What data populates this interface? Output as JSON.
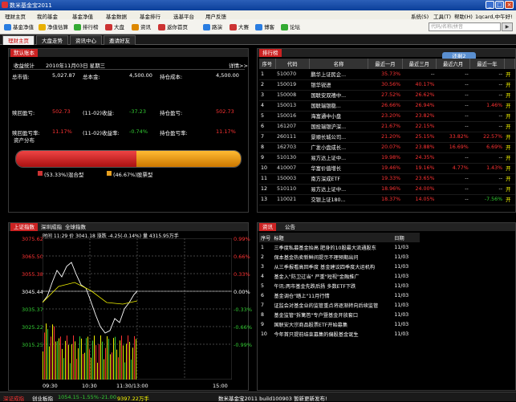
{
  "app": {
    "title": "数米基金宝2011"
  },
  "menu": [
    "理财主页",
    "我的基金",
    "基金净值",
    "基金数据",
    "基金排行",
    "选基平台",
    "用户反馈"
  ],
  "menu_right": [
    "系统(S)",
    "工具(T)",
    "帮助(H)",
    "1qcard,中午好!"
  ],
  "toolbar": [
    {
      "label": "基金净值",
      "icon": "chart-icon",
      "color": "#2a7de1"
    },
    {
      "label": "净值估算",
      "icon": "star-icon",
      "color": "#e8b000"
    },
    {
      "label": "排行榜",
      "icon": "list-icon",
      "color": "#3a3"
    },
    {
      "label": "大盘",
      "icon": "bar-chart-icon",
      "color": "#c33"
    },
    {
      "label": "资讯",
      "icon": "doc-icon",
      "color": "#d80"
    },
    {
      "label": "返你首页",
      "icon": "home-icon",
      "color": "#c33"
    },
    {
      "label": "路演",
      "icon": "mic-icon",
      "color": "#2a7de1"
    },
    {
      "label": "大赛",
      "icon": "trophy-icon",
      "color": "#c33"
    },
    {
      "label": "博客",
      "icon": "blog-icon",
      "color": "#2a7de1"
    },
    {
      "label": "论坛",
      "icon": "forum-icon",
      "color": "#3a3"
    }
  ],
  "search": {
    "placeholder": "代码/名称/拼音",
    "button": "▶"
  },
  "tabs": [
    "理财主页",
    "大盘走势",
    "资讯中心",
    "邀请好友"
  ],
  "account": {
    "tab": "默认账本",
    "header_label": "收益统计",
    "date": "2010年11月03日 星期三",
    "detail_link": "详情>>",
    "rows": [
      [
        {
          "l": "总市值:",
          "v": "5,027.87",
          "c": "white"
        },
        {
          "l": "总本金:",
          "v": "4,500.00",
          "c": "white"
        },
        {
          "l": "持仓成本:",
          "v": "4,500.00",
          "c": "white"
        }
      ],
      [
        {
          "l": "赎回盈亏:",
          "v": "502.73",
          "c": "red"
        },
        {
          "l": "(11-02)收益:",
          "v": "-37.23",
          "c": "green"
        },
        {
          "l": "持仓盈亏:",
          "v": "502.73",
          "c": "red"
        }
      ],
      [
        {
          "l": "赎回盈亏率:",
          "v": "11.17%",
          "c": "red"
        },
        {
          "l": "(11-02)收益率:",
          "v": "-0.74%",
          "c": "green"
        },
        {
          "l": "持仓盈亏率:",
          "v": "11.17%",
          "c": "red"
        }
      ]
    ],
    "distribution_label": "资产分布",
    "legend": [
      {
        "label": "(53.33%)混合型",
        "color": "#c33",
        "share": 0.5333
      },
      {
        "label": "(46.67%)股票型",
        "color": "#e8a020",
        "share": 0.4667
      }
    ]
  },
  "ranking": {
    "tab": "排行榜",
    "more": "还剩2",
    "columns": [
      "序号",
      "代码",
      "名称",
      "最近一月",
      "最近三月",
      "最近六月",
      "最近一年",
      ""
    ],
    "rows": [
      [
        "1",
        "510070",
        "鹏华上证民企...",
        "35.73%",
        "--",
        "--",
        "--",
        "开"
      ],
      [
        "2",
        "150019",
        "银华锐进",
        "30.56%",
        "40.17%",
        "--",
        "--",
        "开"
      ],
      [
        "3",
        "150008",
        "国联安双禧中...",
        "27.52%",
        "26.62%",
        "--",
        "--",
        "开"
      ],
      [
        "4",
        "150013",
        "国联瑞银稳...",
        "26.66%",
        "26.94%",
        "--",
        "1.46%",
        "开"
      ],
      [
        "5",
        "150016",
        "海富通中小盘",
        "23.20%",
        "23.82%",
        "--",
        "--",
        "开"
      ],
      [
        "6",
        "161207",
        "国投瑞银沪深...",
        "21.67%",
        "22.15%",
        "--",
        "--",
        "开"
      ],
      [
        "7",
        "260111",
        "景顺长城公司...",
        "21.20%",
        "25.15%",
        "33.82%",
        "22.57%",
        "开"
      ],
      [
        "8",
        "162703",
        "广发小盘成长...",
        "20.07%",
        "23.88%",
        "16.69%",
        "6.69%",
        "开"
      ],
      [
        "9",
        "510130",
        "易方达上证中...",
        "19.98%",
        "24.35%",
        "--",
        "--",
        "开"
      ],
      [
        "10",
        "410007",
        "华富价值增长",
        "19.46%",
        "19.16%",
        "4.77%",
        "1.43%",
        "开"
      ],
      [
        "11",
        "150003",
        "南方深成ETF",
        "19.33%",
        "23.65%",
        "--",
        "--",
        "开"
      ],
      [
        "12",
        "510110",
        "易方达上证中...",
        "18.96%",
        "24.00%",
        "--",
        "--",
        "开"
      ],
      [
        "13",
        "110021",
        "交银上证180...",
        "18.37%",
        "14.05%",
        "--",
        "-7.56%",
        "开"
      ]
    ]
  },
  "market": {
    "tabs": [
      "上证指数",
      "深圳成指",
      "全球指数"
    ],
    "info": "时间 11:29 价 3041.18 涨跌 -4.25(-0.14%) 量 4315.95万手",
    "y_left": [
      "3075.62",
      "3065.50",
      "3055.38",
      "3045.44",
      "3035.37",
      "3025.22",
      "3015.25"
    ],
    "y_right": [
      "0.99%",
      "0.66%",
      "0.33%",
      "0.00%",
      "-0.33%",
      "-0.66%",
      "-0.99%"
    ],
    "x": [
      "09:30",
      "10:30",
      "11:30/13:00",
      "15:00"
    ]
  },
  "news": {
    "tabs": [
      "资讯",
      "公告"
    ],
    "columns": [
      "序号",
      "标题",
      "日期"
    ],
    "rows": [
      [
        "1",
        "三季度私募基金抬高 肥身的10股最大流通股东",
        "11/03"
      ],
      [
        "2",
        "保本基金热卖新鲜间提示不理预期出问",
        "11/03"
      ],
      [
        "3",
        "从三季报看高回季度 基金建议四季度大运机构",
        "11/03"
      ],
      [
        "4",
        "基金入\"防卫过当\" 严重\"短视\"金融推广",
        "11/03"
      ],
      [
        "5",
        "午讯:两市基金先跌后扬 多数ETF下跌",
        "11/03"
      ],
      [
        "6",
        "基金调仓\"踏上\"11月行情",
        "11/03"
      ],
      [
        "7",
        "证监会对基金业的监管重点将逐渐转向后续监管",
        "11/03"
      ],
      [
        "8",
        "基金监管\"拆篱笆\"专户暨基金开放套口",
        "11/03"
      ],
      [
        "9",
        "国联安大宗商品股票ETF开始募集",
        "11/03"
      ],
      [
        "10",
        "今年首只提前结束募集的偏股基金诞生",
        "11/03"
      ]
    ]
  },
  "status": {
    "index_name": "深证成指",
    "index_val": "",
    "gem_name": "创业板指",
    "gem_val": "1054.15",
    "gem_pct": "-1.55%",
    "gem_chg": "-21.00",
    "gem_vol": "9397.22万手",
    "version": "数米基金宝2011 build100903 暂新更新发布!"
  }
}
